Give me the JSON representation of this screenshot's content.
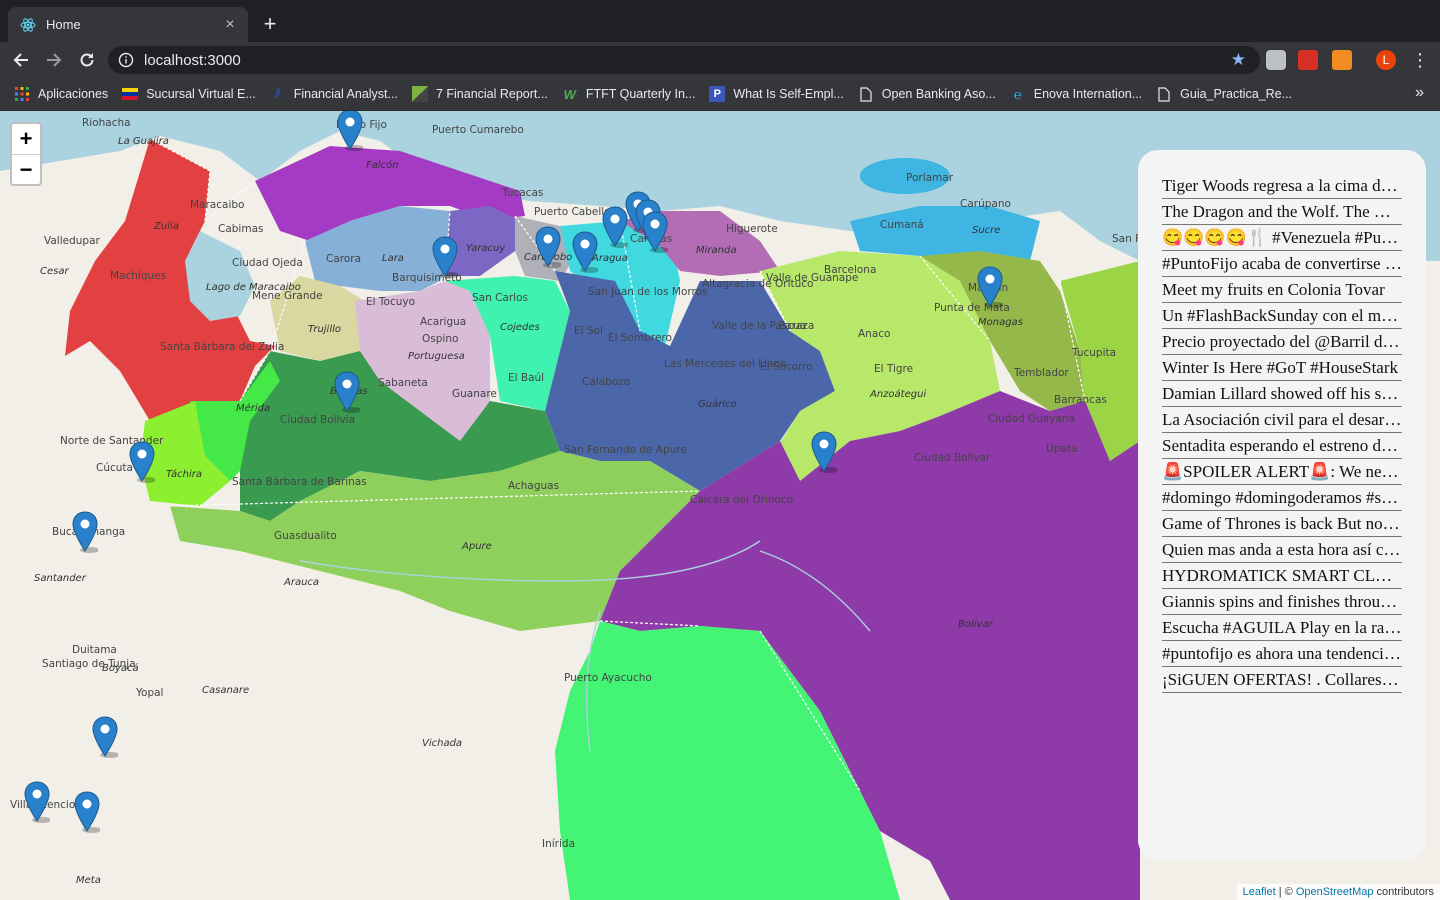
{
  "browser": {
    "tab_title": "Home",
    "tab_close": "×",
    "new_tab": "+",
    "url": "localhost:3000",
    "avatar_letter": "L",
    "bookmarks_more": "»"
  },
  "bookmarks": [
    {
      "label": "Aplicaciones",
      "icon": "apps-grid-icon"
    },
    {
      "label": "Sucursal Virtual E...",
      "icon": "bank-flag-icon"
    },
    {
      "label": "Financial Analyst...",
      "icon": "finance-logo-icon"
    },
    {
      "label": "7 Financial Report...",
      "icon": "report-icon"
    },
    {
      "label": "FTFT Quarterly In...",
      "icon": "w-logo-icon"
    },
    {
      "label": "What Is Self-Empl...",
      "icon": "p-logo-icon"
    },
    {
      "label": "Open Banking Aso...",
      "icon": "document-icon"
    },
    {
      "label": "Enova Internation...",
      "icon": "enova-logo-icon"
    },
    {
      "label": "Guia_Practica_Re...",
      "icon": "document-icon"
    }
  ],
  "map": {
    "zoom_in": "+",
    "zoom_out": "−",
    "attribution_leaflet": "Leaflet",
    "attribution_sep": " | © ",
    "attribution_osm": "OpenStreetMap",
    "attribution_tail": " contributors",
    "labels": [
      "Riohacha",
      "La Guajira",
      "Punto Fijo",
      "Puerto Cumarebo",
      "Falcón",
      "Tucacas",
      "Maracaibo",
      "Valledupar",
      "Zulia",
      "Cabimas",
      "Cesar",
      "Machiques",
      "Ciudad Ojeda",
      "Lago de Maracaibo",
      "Mene Grande",
      "Santa Bárbara del Zulia",
      "Carora",
      "Lara",
      "Barquisimeto",
      "Yaracuy",
      "Puerto Cabello",
      "Carabobo",
      "Aragua",
      "Caracas",
      "Miranda",
      "Higuerote",
      "El Tocuyo",
      "Trujillo",
      "Acarigua",
      "Portuguesa",
      "San Carlos",
      "Cojedes",
      "Ospino",
      "Guanare",
      "Sabaneta",
      "Barinas",
      "Mérida",
      "Táchira",
      "Cúcuta",
      "Norte de Santander",
      "Bucaramanga",
      "Santander",
      "Guasdualito",
      "Apure",
      "Arauca",
      "Achaguas",
      "San Juan de los Morros",
      "El Sombrero",
      "Calabozo",
      "Guárico",
      "Valle de la Pascua",
      "Las Mercedes del Llano",
      "El Socorro",
      "Zaraza",
      "Altagracia de Orituco",
      "Barcelona",
      "Valle de Guanape",
      "Anaco",
      "El Tigre",
      "Anzoátegui",
      "Maturín",
      "Monagas",
      "Punta de Mata",
      "Temblador",
      "Tucupita",
      "Barrancas",
      "Ciudad Guayana",
      "Upata",
      "Ciudad Bolívar",
      "Caicara del Orinoco",
      "San Fernando de Apure",
      "Bolívar",
      "Puerto Ayacucho",
      "Inírida",
      "Vichada",
      "Casanare",
      "Yopal",
      "Boyacá",
      "Duitama",
      "Santiago de Tunja",
      "Villavicencio",
      "Meta",
      "Porlamar",
      "Carúpano",
      "Cumaná",
      "Sucre",
      "San Fe",
      "El Baúl",
      "Ciudad Bolivia",
      "Santa Bárbara de Barinas",
      "El Sol"
    ]
  },
  "tweets": [
    "Tiger Woods regresa a la cima del golf mundial",
    "The Dragon and the Wolf. The North remembers",
    "😋😋😋😋🍴 #Venezuela #PuntoFijo",
    "#PuntoFijo acaba de convertirse en tendencia",
    "Meet my fruits en Colonia Tovar",
    "Un #FlashBackSunday con el mejor equipo",
    "Precio proyectado del @Barril de petróleo",
    "Winter Is Here #GoT #HouseStark",
    "Damian Lillard showed off his skills",
    "La Asociación civil para el desarrollo",
    "Sentadita esperando el estreno de GoT",
    "🚨SPOILER ALERT🚨: We need to talk",
    "#domingo #domingoderamos #semanasanta",
    "Game of Thrones is back But not for all",
    "Quien mas anda a esta hora así como yo",
    "HYDROMATICK SMART CLEAN SYSTEM",
    "Giannis spins and finishes through contact",
    "Escucha #AGUILA Play en la radio",
    "#puntofijo es ahora una tendencia en VE",
    "¡SiGUEN OFERTAS! . Collares y pulseras"
  ]
}
